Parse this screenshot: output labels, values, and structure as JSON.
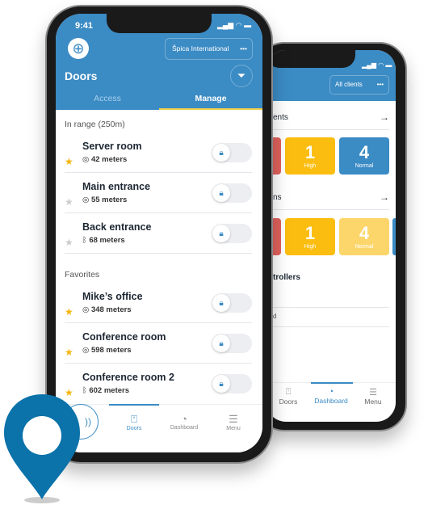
{
  "back_phone": {
    "client_selector": "All clients",
    "more_label": "•••",
    "section1_title": "ents",
    "section2_title": "ns",
    "section3_title": "trollers",
    "section3_item": "d",
    "tiles1": [
      {
        "value": "1",
        "label": "High",
        "color": "#fbbd10"
      },
      {
        "value": "4",
        "label": "Normal",
        "color": "#3b8bc4"
      }
    ],
    "tiles2": [
      {
        "value": "1",
        "label": "High",
        "color": "#fbbd10"
      },
      {
        "value": "4",
        "label": "Normal",
        "color": "#fcd66b"
      }
    ],
    "nav": [
      {
        "label": "Doors",
        "icon": "door-icon"
      },
      {
        "label": "Dashboard",
        "icon": "dashboard-icon",
        "active": true
      },
      {
        "label": "Menu",
        "icon": "menu-icon"
      }
    ]
  },
  "front_phone": {
    "time": "9:41",
    "client_selector": "Špica International",
    "more_label": "•••",
    "title": "Doors",
    "tabs": [
      {
        "label": "Access"
      },
      {
        "label": "Manage",
        "active": true
      }
    ],
    "in_range_label": "In range (250m)",
    "in_range": [
      {
        "name": "Server room",
        "distance": "42 meters",
        "favorite": true,
        "conn": "location"
      },
      {
        "name": "Main entrance",
        "distance": "55 meters",
        "favorite": false,
        "conn": "location"
      },
      {
        "name": "Back entrance",
        "distance": "68 meters",
        "favorite": false,
        "conn": "bluetooth"
      }
    ],
    "favorites_label": "Favorites",
    "favorites": [
      {
        "name": "Mike’s office",
        "distance": "348 meters",
        "favorite": true,
        "conn": "location"
      },
      {
        "name": "Conference room",
        "distance": "598 meters",
        "favorite": true,
        "conn": "location"
      },
      {
        "name": "Conference room 2",
        "distance": "602 meters",
        "favorite": true,
        "conn": "bluetooth"
      }
    ],
    "nav": [
      {
        "label": "Doors",
        "icon": "door-icon",
        "active": true
      },
      {
        "label": "Dashboard",
        "icon": "dashboard-icon"
      },
      {
        "label": "Menu",
        "icon": "menu-icon"
      }
    ]
  },
  "colors": {
    "brand_blue": "#3b8bc4",
    "accent_yellow": "#fbbd10",
    "alert_red": "#e0615c",
    "pin_blue": "#0b72aa"
  }
}
